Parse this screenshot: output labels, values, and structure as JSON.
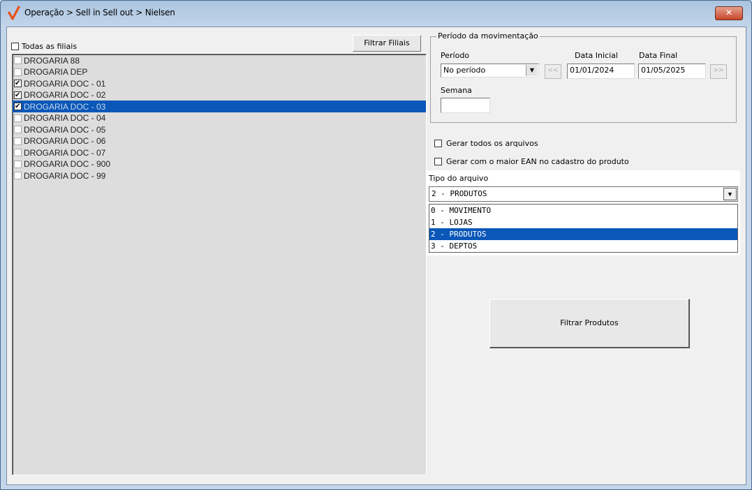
{
  "window": {
    "title": "Operação > Sell in Sell out > Nielsen",
    "close_label": "✕"
  },
  "filiais": {
    "todas_label": "Todas as filiais",
    "filter_button": "Filtrar Filiais",
    "items": [
      {
        "label": "DROGARIA 88",
        "checked": false,
        "selected": false
      },
      {
        "label": "DROGARIA DEP",
        "checked": false,
        "selected": false
      },
      {
        "label": "DROGARIA DOC - 01",
        "checked": true,
        "selected": false
      },
      {
        "label": "DROGARIA DOC - 02",
        "checked": true,
        "selected": false
      },
      {
        "label": "DROGARIA DOC - 03",
        "checked": true,
        "selected": true
      },
      {
        "label": "DROGARIA DOC - 04",
        "checked": false,
        "selected": false
      },
      {
        "label": "DROGARIA DOC - 05",
        "checked": false,
        "selected": false
      },
      {
        "label": "DROGARIA DOC - 06",
        "checked": false,
        "selected": false
      },
      {
        "label": "DROGARIA DOC - 07",
        "checked": false,
        "selected": false
      },
      {
        "label": "DROGARIA DOC - 900",
        "checked": false,
        "selected": false
      },
      {
        "label": "DROGARIA DOC - 99",
        "checked": false,
        "selected": false
      }
    ]
  },
  "periodo": {
    "group_label": "Período da movimentação",
    "periodo_label": "Período",
    "periodo_value": "No período",
    "prev_label": "<<",
    "next_label": ">>",
    "data_inicial_label": "Data Inicial",
    "data_inicial_value": "01/01/2024",
    "data_final_label": "Data Final",
    "data_final_value": "01/05/2025",
    "semana_label": "Semana",
    "semana_value": ""
  },
  "options": {
    "gerar_todos": "Gerar todos os arquivos",
    "gerar_ean": "Gerar com o maior EAN no cadastro do produto"
  },
  "tipo_arquivo": {
    "label": "Tipo do arquivo",
    "selected": "2 - PRODUTOS",
    "options": [
      "0 - MOVIMENTO",
      "1 - LOJAS",
      "2 - PRODUTOS",
      "3 - DEPTOS"
    ],
    "selected_index": 2
  },
  "actions": {
    "filtrar_produtos": "Filtrar Produtos"
  }
}
